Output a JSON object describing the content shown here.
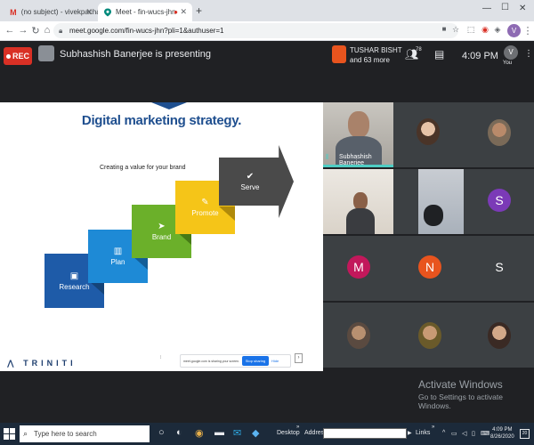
{
  "browser": {
    "tabs": [
      {
        "title": "(no subject) - vivekpachauri@t...",
        "favicon": "gmail-icon",
        "favicon_color": "#d93025"
      },
      {
        "title": "Meet - fin-wucs-jhn",
        "favicon": "meet-icon",
        "favicon_color": "#00897b"
      }
    ],
    "url": "meet.google.com/fin-wucs-jhn?pli=1&authuser=1",
    "profile_initial": "V"
  },
  "meet": {
    "rec_label": "REC",
    "presenter_text": "Subhashish Banerjee is presenting",
    "participant_name": "TUSHAR BISHT",
    "participant_more": "and 63 more",
    "people_count": "78",
    "time": "4:09 PM",
    "you_label": "You",
    "you_initial": "V",
    "accent": "#4ecdc4"
  },
  "slide": {
    "title": "Digital marketing strategy.",
    "subtitle": "Creating a value for your brand",
    "steps": [
      {
        "label": "Research",
        "icon": "document-icon",
        "color": "#1e5ba8"
      },
      {
        "label": "Plan",
        "icon": "bar-chart-icon",
        "color": "#1e8ad6"
      },
      {
        "label": "Brand",
        "icon": "paper-plane-icon",
        "color": "#6bb02a"
      },
      {
        "label": "Promote",
        "icon": "rocket-icon",
        "color": "#f5c518"
      },
      {
        "label": "Serve",
        "icon": "check-icon",
        "color": "#4a4a4a"
      }
    ],
    "logo": "TRINITI",
    "share_text": "meet.google.com is sharing your screen.",
    "stop_label": "Stop sharing",
    "hide_label": "Hide"
  },
  "tiles": {
    "speaker_name": "Subhashish Banerjee",
    "avatars": [
      {
        "letter": "S",
        "color": "#e8541e"
      },
      {
        "letter": "M",
        "color": "#7b3ab7"
      },
      {
        "letter": "N",
        "color": "#c2185b"
      },
      {
        "letter": "S",
        "color": "#e8541e"
      }
    ]
  },
  "watermark": {
    "line1": "Activate Windows",
    "line2": "Go to Settings to activate Windows."
  },
  "taskbar": {
    "search_placeholder": "Type here to search",
    "desktop_label": "Desktop",
    "address_label": "Address",
    "links_label": "Links",
    "time": "4:09 PM",
    "date": "8/26/2020",
    "notifications": "20"
  }
}
